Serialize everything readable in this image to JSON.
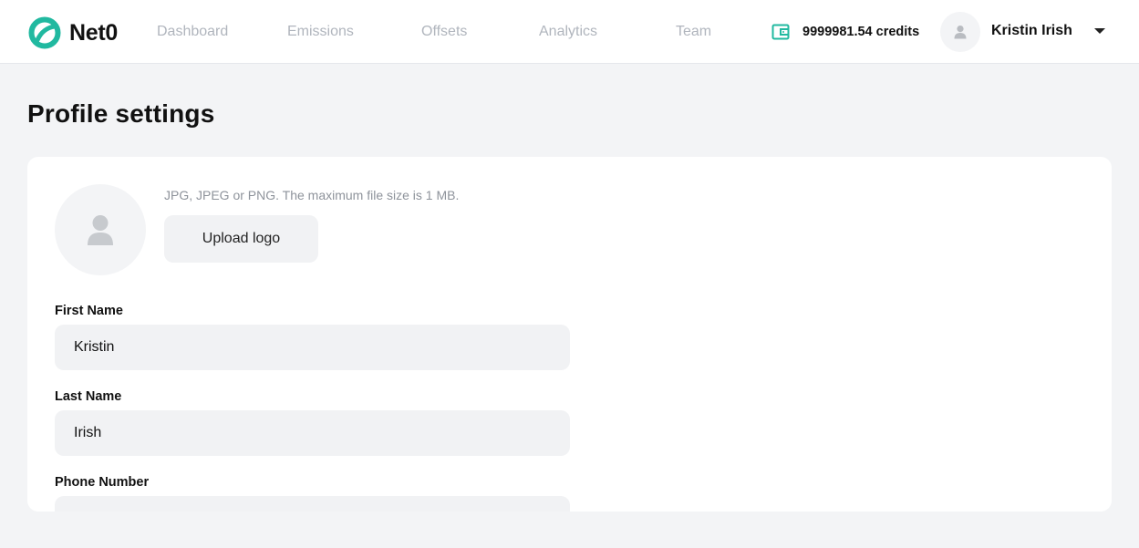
{
  "brand": {
    "name": "Net0",
    "accent": "#21b9a0"
  },
  "nav": {
    "items": [
      {
        "label": "Dashboard"
      },
      {
        "label": "Emissions"
      },
      {
        "label": "Offsets"
      },
      {
        "label": "Analytics"
      },
      {
        "label": "Team"
      }
    ]
  },
  "header": {
    "credits": "9999981.54 credits",
    "wallet_icon": "wallet-icon",
    "user_name": "Kristin Irish",
    "caret_icon": "caret-down-icon"
  },
  "page": {
    "title": "Profile settings"
  },
  "profile": {
    "upload_hint": "JPG, JPEG or PNG. The maximum file size is 1 MB.",
    "upload_label": "Upload logo",
    "fields": [
      {
        "label": "First Name",
        "value": "Kristin"
      },
      {
        "label": "Last Name",
        "value": "Irish"
      },
      {
        "label": "Phone Number",
        "value": ""
      }
    ]
  }
}
